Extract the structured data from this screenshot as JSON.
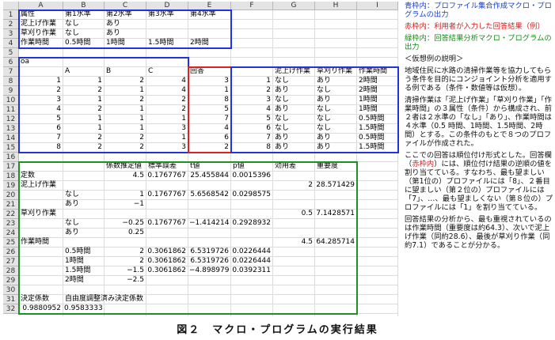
{
  "sheet": {
    "columns": [
      "A",
      "B",
      "C",
      "D",
      "E",
      "F",
      "G",
      "H",
      "I"
    ],
    "rows": [
      "1",
      "2",
      "3",
      "4",
      "5",
      "6",
      "7",
      "8",
      "9",
      "10",
      "11",
      "12",
      "13",
      "14",
      "15",
      "16",
      "17",
      "18",
      "19",
      "20",
      "21",
      "22",
      "23",
      "24",
      "25",
      "26",
      "27",
      "28",
      "29",
      "30",
      "31",
      "32"
    ],
    "cells": [
      {
        "r": 1,
        "c": "A",
        "v": "属性"
      },
      {
        "r": 1,
        "c": "B",
        "v": "第1水準"
      },
      {
        "r": 1,
        "c": "C",
        "v": "第2水準"
      },
      {
        "r": 1,
        "c": "D",
        "v": "第3水準"
      },
      {
        "r": 1,
        "c": "E",
        "v": "第4水準"
      },
      {
        "r": 2,
        "c": "A",
        "v": "泥上げ作業"
      },
      {
        "r": 2,
        "c": "B",
        "v": "なし"
      },
      {
        "r": 2,
        "c": "C",
        "v": "あり"
      },
      {
        "r": 3,
        "c": "A",
        "v": "草刈り作業"
      },
      {
        "r": 3,
        "c": "B",
        "v": "なし"
      },
      {
        "r": 3,
        "c": "C",
        "v": "あり"
      },
      {
        "r": 4,
        "c": "A",
        "v": "作業時間"
      },
      {
        "r": 4,
        "c": "B",
        "v": "0.5時間"
      },
      {
        "r": 4,
        "c": "C",
        "v": "1時間"
      },
      {
        "r": 4,
        "c": "D",
        "v": "1.5時間"
      },
      {
        "r": 4,
        "c": "E",
        "v": "2時間"
      },
      {
        "r": 6,
        "c": "A",
        "v": "oa"
      },
      {
        "r": 7,
        "c": "B",
        "v": "A"
      },
      {
        "r": 7,
        "c": "C",
        "v": "B"
      },
      {
        "r": 7,
        "c": "D",
        "v": "C"
      },
      {
        "r": 7,
        "c": "E",
        "v": "回答"
      },
      {
        "r": 7,
        "c": "G",
        "v": "泥上げ作業"
      },
      {
        "r": 7,
        "c": "H",
        "v": "草刈り作業"
      },
      {
        "r": 7,
        "c": "I",
        "v": "作業時間"
      },
      {
        "r": 8,
        "c": "A",
        "v": "1",
        "n": 1
      },
      {
        "r": 8,
        "c": "B",
        "v": "1",
        "n": 1
      },
      {
        "r": 8,
        "c": "C",
        "v": "2",
        "n": 1
      },
      {
        "r": 8,
        "c": "D",
        "v": "4",
        "n": 1
      },
      {
        "r": 8,
        "c": "E",
        "v": "3",
        "n": 1
      },
      {
        "r": 8,
        "c": "F",
        "v": "1",
        "n": 1
      },
      {
        "r": 8,
        "c": "G",
        "v": "なし"
      },
      {
        "r": 8,
        "c": "H",
        "v": "あり"
      },
      {
        "r": 8,
        "c": "I",
        "v": "2時間"
      },
      {
        "r": 9,
        "c": "A",
        "v": "2",
        "n": 1
      },
      {
        "r": 9,
        "c": "B",
        "v": "2",
        "n": 1
      },
      {
        "r": 9,
        "c": "C",
        "v": "1",
        "n": 1
      },
      {
        "r": 9,
        "c": "D",
        "v": "4",
        "n": 1
      },
      {
        "r": 9,
        "c": "E",
        "v": "1",
        "n": 1
      },
      {
        "r": 9,
        "c": "F",
        "v": "2",
        "n": 1
      },
      {
        "r": 9,
        "c": "G",
        "v": "あり"
      },
      {
        "r": 9,
        "c": "H",
        "v": "なし"
      },
      {
        "r": 9,
        "c": "I",
        "v": "2時間"
      },
      {
        "r": 10,
        "c": "A",
        "v": "3",
        "n": 1
      },
      {
        "r": 10,
        "c": "B",
        "v": "1",
        "n": 1
      },
      {
        "r": 10,
        "c": "C",
        "v": "2",
        "n": 1
      },
      {
        "r": 10,
        "c": "D",
        "v": "2",
        "n": 1
      },
      {
        "r": 10,
        "c": "E",
        "v": "8",
        "n": 1
      },
      {
        "r": 10,
        "c": "F",
        "v": "3",
        "n": 1
      },
      {
        "r": 10,
        "c": "G",
        "v": "なし"
      },
      {
        "r": 10,
        "c": "H",
        "v": "あり"
      },
      {
        "r": 10,
        "c": "I",
        "v": "1時間"
      },
      {
        "r": 11,
        "c": "A",
        "v": "4",
        "n": 1
      },
      {
        "r": 11,
        "c": "B",
        "v": "2",
        "n": 1
      },
      {
        "r": 11,
        "c": "C",
        "v": "1",
        "n": 1
      },
      {
        "r": 11,
        "c": "D",
        "v": "2",
        "n": 1
      },
      {
        "r": 11,
        "c": "E",
        "v": "5",
        "n": 1
      },
      {
        "r": 11,
        "c": "F",
        "v": "4",
        "n": 1
      },
      {
        "r": 11,
        "c": "G",
        "v": "あり"
      },
      {
        "r": 11,
        "c": "H",
        "v": "なし"
      },
      {
        "r": 11,
        "c": "I",
        "v": "1時間"
      },
      {
        "r": 12,
        "c": "A",
        "v": "5",
        "n": 1
      },
      {
        "r": 12,
        "c": "B",
        "v": "1",
        "n": 1
      },
      {
        "r": 12,
        "c": "C",
        "v": "1",
        "n": 1
      },
      {
        "r": 12,
        "c": "D",
        "v": "1",
        "n": 1
      },
      {
        "r": 12,
        "c": "E",
        "v": "7",
        "n": 1
      },
      {
        "r": 12,
        "c": "F",
        "v": "5",
        "n": 1
      },
      {
        "r": 12,
        "c": "G",
        "v": "なし"
      },
      {
        "r": 12,
        "c": "H",
        "v": "なし"
      },
      {
        "r": 12,
        "c": "I",
        "v": "0.5時間"
      },
      {
        "r": 13,
        "c": "A",
        "v": "6",
        "n": 1
      },
      {
        "r": 13,
        "c": "B",
        "v": "1",
        "n": 1
      },
      {
        "r": 13,
        "c": "C",
        "v": "1",
        "n": 1
      },
      {
        "r": 13,
        "c": "D",
        "v": "3",
        "n": 1
      },
      {
        "r": 13,
        "c": "E",
        "v": "4",
        "n": 1
      },
      {
        "r": 13,
        "c": "F",
        "v": "6",
        "n": 1
      },
      {
        "r": 13,
        "c": "G",
        "v": "なし"
      },
      {
        "r": 13,
        "c": "H",
        "v": "なし"
      },
      {
        "r": 13,
        "c": "I",
        "v": "1.5時間"
      },
      {
        "r": 14,
        "c": "A",
        "v": "7",
        "n": 1
      },
      {
        "r": 14,
        "c": "B",
        "v": "2",
        "n": 1
      },
      {
        "r": 14,
        "c": "C",
        "v": "2",
        "n": 1
      },
      {
        "r": 14,
        "c": "D",
        "v": "1",
        "n": 1
      },
      {
        "r": 14,
        "c": "E",
        "v": "6",
        "n": 1
      },
      {
        "r": 14,
        "c": "F",
        "v": "7",
        "n": 1
      },
      {
        "r": 14,
        "c": "G",
        "v": "あり"
      },
      {
        "r": 14,
        "c": "H",
        "v": "あり"
      },
      {
        "r": 14,
        "c": "I",
        "v": "0.5時間"
      },
      {
        "r": 15,
        "c": "A",
        "v": "8",
        "n": 1
      },
      {
        "r": 15,
        "c": "B",
        "v": "2",
        "n": 1
      },
      {
        "r": 15,
        "c": "C",
        "v": "2",
        "n": 1
      },
      {
        "r": 15,
        "c": "D",
        "v": "3",
        "n": 1
      },
      {
        "r": 15,
        "c": "E",
        "v": "2",
        "n": 1
      },
      {
        "r": 15,
        "c": "F",
        "v": "8",
        "n": 1
      },
      {
        "r": 15,
        "c": "G",
        "v": "あり"
      },
      {
        "r": 15,
        "c": "H",
        "v": "あり"
      },
      {
        "r": 15,
        "c": "I",
        "v": "1.5時間"
      },
      {
        "r": 17,
        "c": "C",
        "v": "係数推定値"
      },
      {
        "r": 17,
        "c": "D",
        "v": "標準誤差"
      },
      {
        "r": 17,
        "c": "E",
        "v": "t値"
      },
      {
        "r": 17,
        "c": "F",
        "v": "p値"
      },
      {
        "r": 17,
        "c": "G",
        "v": "効用差"
      },
      {
        "r": 17,
        "c": "H",
        "v": "重要度"
      },
      {
        "r": 18,
        "c": "A",
        "v": "定数"
      },
      {
        "r": 18,
        "c": "C",
        "v": "4.5",
        "n": 1
      },
      {
        "r": 18,
        "c": "D",
        "v": "0.1767767",
        "n": 1
      },
      {
        "r": 18,
        "c": "E",
        "v": "25.455844",
        "n": 1
      },
      {
        "r": 18,
        "c": "F",
        "v": "0.0015396",
        "n": 1
      },
      {
        "r": 19,
        "c": "A",
        "v": "泥上げ作業"
      },
      {
        "r": 19,
        "c": "G",
        "v": "2",
        "n": 1
      },
      {
        "r": 19,
        "c": "H",
        "v": "28.571429",
        "n": 1
      },
      {
        "r": 20,
        "c": "B",
        "v": "なし"
      },
      {
        "r": 20,
        "c": "C",
        "v": "1",
        "n": 1
      },
      {
        "r": 20,
        "c": "D",
        "v": "0.1767767",
        "n": 1
      },
      {
        "r": 20,
        "c": "E",
        "v": "5.6568542",
        "n": 1
      },
      {
        "r": 20,
        "c": "F",
        "v": "0.0298575",
        "n": 1
      },
      {
        "r": 21,
        "c": "B",
        "v": "あり"
      },
      {
        "r": 21,
        "c": "C",
        "v": "−1",
        "n": 1
      },
      {
        "r": 22,
        "c": "A",
        "v": "草刈り作業"
      },
      {
        "r": 22,
        "c": "G",
        "v": "0.5",
        "n": 1
      },
      {
        "r": 22,
        "c": "H",
        "v": "7.1428571",
        "n": 1
      },
      {
        "r": 23,
        "c": "B",
        "v": "なし"
      },
      {
        "r": 23,
        "c": "C",
        "v": "−0.25",
        "n": 1
      },
      {
        "r": 23,
        "c": "D",
        "v": "0.1767767",
        "n": 1
      },
      {
        "r": 23,
        "c": "E",
        "v": "−1.414214",
        "n": 1
      },
      {
        "r": 23,
        "c": "F",
        "v": "0.2928932",
        "n": 1
      },
      {
        "r": 24,
        "c": "B",
        "v": "あり"
      },
      {
        "r": 24,
        "c": "C",
        "v": "0.25",
        "n": 1
      },
      {
        "r": 25,
        "c": "A",
        "v": "作業時間"
      },
      {
        "r": 25,
        "c": "G",
        "v": "4.5",
        "n": 1
      },
      {
        "r": 25,
        "c": "H",
        "v": "64.285714",
        "n": 1
      },
      {
        "r": 26,
        "c": "B",
        "v": "0.5時間"
      },
      {
        "r": 26,
        "c": "C",
        "v": "2",
        "n": 1
      },
      {
        "r": 26,
        "c": "D",
        "v": "0.3061862",
        "n": 1
      },
      {
        "r": 26,
        "c": "E",
        "v": "6.5319726",
        "n": 1
      },
      {
        "r": 26,
        "c": "F",
        "v": "0.0226444",
        "n": 1
      },
      {
        "r": 27,
        "c": "B",
        "v": "1時間"
      },
      {
        "r": 27,
        "c": "C",
        "v": "2",
        "n": 1
      },
      {
        "r": 27,
        "c": "D",
        "v": "0.3061862",
        "n": 1
      },
      {
        "r": 27,
        "c": "E",
        "v": "6.5319726",
        "n": 1
      },
      {
        "r": 27,
        "c": "F",
        "v": "0.0226444",
        "n": 1
      },
      {
        "r": 28,
        "c": "B",
        "v": "1.5時間"
      },
      {
        "r": 28,
        "c": "C",
        "v": "−1.5",
        "n": 1
      },
      {
        "r": 28,
        "c": "D",
        "v": "0.3061862",
        "n": 1
      },
      {
        "r": 28,
        "c": "E",
        "v": "−4.898979",
        "n": 1
      },
      {
        "r": 28,
        "c": "F",
        "v": "0.0392311",
        "n": 1
      },
      {
        "r": 29,
        "c": "B",
        "v": "2時間"
      },
      {
        "r": 29,
        "c": "C",
        "v": "−2.5",
        "n": 1
      },
      {
        "r": 31,
        "c": "A",
        "v": "決定係数"
      },
      {
        "r": 31,
        "c": "B",
        "v": "自由度調整済み決定係数"
      },
      {
        "r": 32,
        "c": "A",
        "v": "0.9880952",
        "n": 1
      },
      {
        "r": 32,
        "c": "B",
        "v": "0.9583333",
        "n": 1
      }
    ]
  },
  "notes": {
    "blue_label": "青枠内",
    "blue_text": "：プロファイル集合作成マクロ・プログラムの出力",
    "red_label": "赤枠内",
    "red_text": "：利用者が入力した回答結果（例）",
    "green_label": "緑枠内",
    "green_text": "：回答結果分析マクロ・プログラムの出力",
    "example_heading": "＜仮想例の説明＞",
    "p1": "地域住民に水路の清掃作業等を協力してもらう条件を目的にコンジョイント分析を適用する例である（条件・数値等は仮想）。",
    "p2": "清掃作業は「泥上げ作業」「草刈り作業」「作業時間」の３属性（条件）から構成され、前２者は２水準の「なし」「あり」、作業時間は４水準（0.5 時間、1時間、1.5時間、2時間）とする。この条件のもとで８つのプロファイルが作成された。",
    "p3_before": "ここでの回答は順位付け形式とした。回答欄（",
    "p3_red": "赤枠内",
    "p3_after": "）には、順位付け結果の逆順の値を割り当てている。すなわち、最も望ましい（第1位の）プロファイルには「8」、２番目に望ましい（第２位の）プロファイルには「7」、…、最も望ましくない（第８位の）プロファイルには「1」を割り当てている。",
    "p4": "回答結果の分析から、最も重視されているのは作業時間（重要度は約64.3）、次いで泥上げ作業（同約28.6）、最後が草刈り作業（同約7.1）であることが分かる。"
  },
  "caption": "図２　マクロ・プログラムの実行結果",
  "colors": {
    "blue_frame": "#2233dd",
    "red_frame": "#e02020",
    "green_frame": "#209020"
  }
}
